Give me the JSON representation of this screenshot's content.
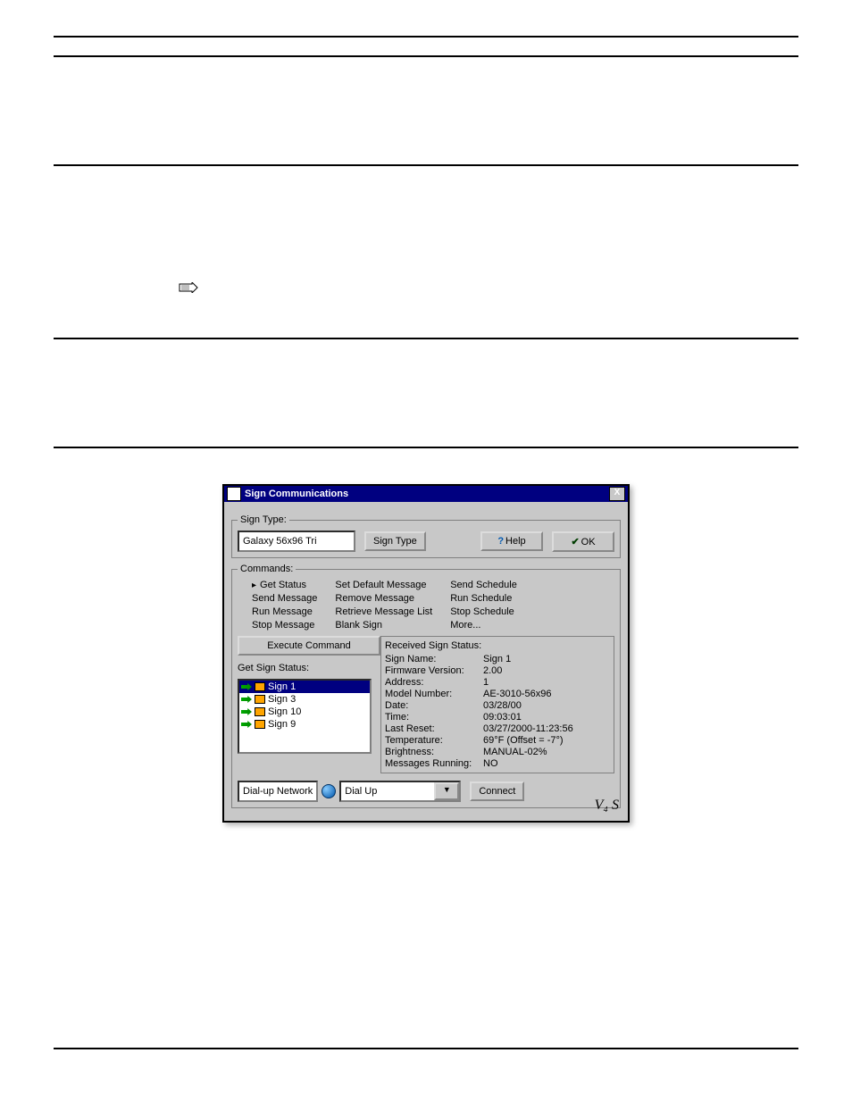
{
  "window": {
    "title": "Sign Communications"
  },
  "top": {
    "sign_type_label": "Sign Type:",
    "sign_type_value": "Galaxy 56x96 Tri",
    "sign_type_button": "Sign Type",
    "help_label": "Help",
    "ok_label": "OK"
  },
  "commands": {
    "legend": "Commands:",
    "col1": [
      "Get Status",
      "Send Message",
      "Run Message",
      "Stop Message"
    ],
    "col2": [
      "Set Default Message",
      "Remove Message",
      "Retrieve Message List",
      "Blank Sign"
    ],
    "col3": [
      "Send Schedule",
      "Run Schedule",
      "Stop Schedule",
      "More..."
    ],
    "execute": "Execute Command"
  },
  "signs": {
    "label": "Get Sign Status:",
    "items": [
      "Sign 1",
      "Sign 3",
      "Sign 10",
      "Sign 9"
    ],
    "selected": 0
  },
  "status": {
    "legend": "Received Sign Status:",
    "rows": [
      {
        "k": "Sign Name:",
        "v": "Sign 1"
      },
      {
        "k": "Firmware Version:",
        "v": "2.00"
      },
      {
        "k": "Address:",
        "v": "1"
      },
      {
        "k": "Model Number:",
        "v": "AE-3010-56x96"
      },
      {
        "k": "Date:",
        "v": "03/28/00"
      },
      {
        "k": "Time:",
        "v": "09:03:01"
      },
      {
        "k": "Last Reset:",
        "v": "03/27/2000-11:23:56"
      },
      {
        "k": "Temperature:",
        "v": "69°F (Offset = -7°)"
      },
      {
        "k": "Brightness:",
        "v": "MANUAL-02%"
      },
      {
        "k": "Messages Running:",
        "v": "NO"
      }
    ]
  },
  "bottom": {
    "network_label": "Dial-up Network",
    "network_value": "Dial Up",
    "connect": "Connect"
  },
  "footer": "V₄ S"
}
